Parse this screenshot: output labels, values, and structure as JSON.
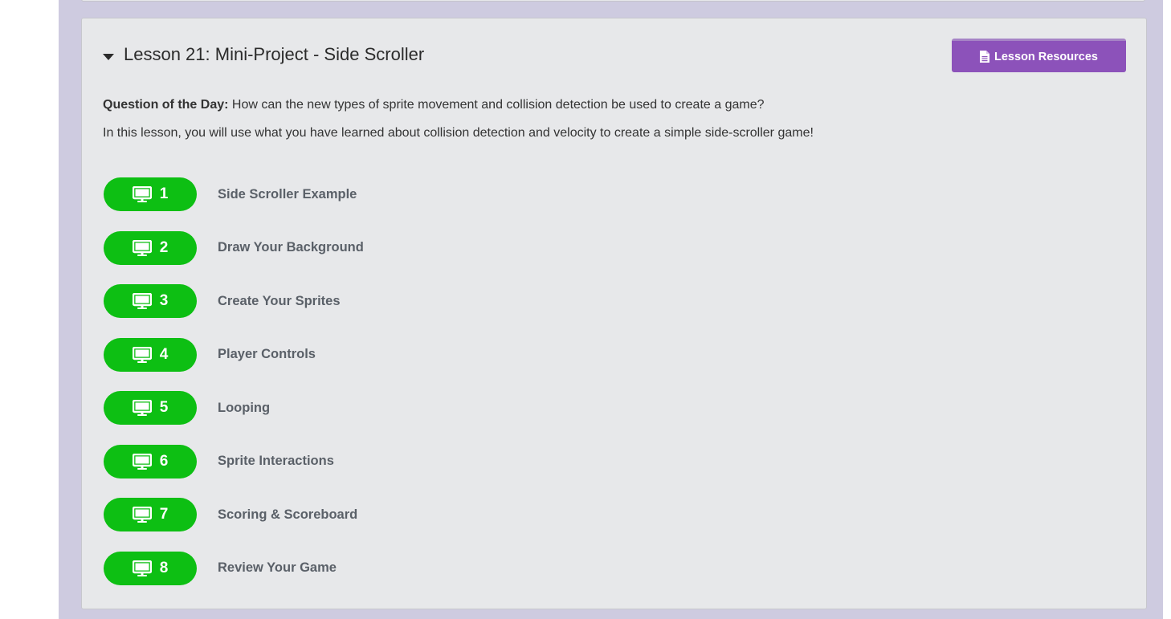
{
  "lesson": {
    "title": "Lesson 21: Mini-Project - Side Scroller",
    "resources_label": "Lesson Resources",
    "question_label": "Question of the Day:",
    "question_text": " How can the new types of sprite movement and collision detection be used to create a game?",
    "description": "In this lesson, you will use what you have learned about collision detection and velocity to create a simple side-scroller game!"
  },
  "levels": [
    {
      "number": "1",
      "label": "Side Scroller Example"
    },
    {
      "number": "2",
      "label": "Draw Your Background"
    },
    {
      "number": "3",
      "label": "Create Your Sprites"
    },
    {
      "number": "4",
      "label": "Player Controls"
    },
    {
      "number": "5",
      "label": "Looping"
    },
    {
      "number": "6",
      "label": "Sprite Interactions"
    },
    {
      "number": "7",
      "label": "Scoring & Scoreboard"
    },
    {
      "number": "8",
      "label": "Review Your Game"
    }
  ],
  "colors": {
    "level_pill": "#0dbf13",
    "resources_button": "#8c52ba",
    "panel_background": "#cecbe0",
    "card_background": "#e7e8ea"
  },
  "icons": {
    "caret": "caret-down-icon",
    "resources": "document-icon",
    "level": "monitor-icon"
  }
}
